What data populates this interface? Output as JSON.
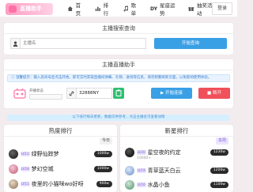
{
  "header": {
    "logo_text": "直播助手",
    "nav": [
      {
        "label": "首页",
        "icon": "home-icon"
      },
      {
        "label": "排行",
        "icon": "chart-icon"
      },
      {
        "label": "歌单",
        "icon": "music-icon"
      },
      {
        "label": "星座运势",
        "prefix": "DY",
        "icon": "star-icon"
      },
      {
        "label": "抽奖活动",
        "badge": "HOT",
        "icon": "gift-icon"
      }
    ],
    "login_label": "登录"
  },
  "query_card": {
    "title": "主播搜索查询",
    "input_placeholder": "主播名",
    "button_label": "开始查询",
    "icon": "user-icon"
  },
  "tool_card": {
    "title": "主播直播助手",
    "notice": "温馨提示：输入房间号后点击开始，即可实时获取直播间弹幕、礼物、进场等信息，请勿频繁刷新页面，以免影响使用体验。",
    "status_label": "开播状态",
    "room_label": "房间号",
    "room_value": "32888NY",
    "start_label": "开始连接",
    "stop_label": "断开"
  },
  "banner_text": "以下排行每日更新，数据仅供参考，点击主播名可查看详情",
  "left_panel": {
    "title": "热度排行",
    "tab_label": "今日",
    "rows": [
      {
        "name": "绿野仙踪梦",
        "count": "1000w",
        "level": "LV12"
      },
      {
        "name": "梦幻空城",
        "count": "1000w",
        "level": "LV18"
      },
      {
        "name": "夜里的小猫咪wo好呀",
        "count": "900w",
        "level": "LV11"
      }
    ]
  },
  "right_panel": {
    "title": "新星排行",
    "tab_label": "本周",
    "rows": [
      {
        "name": "星空夜的约定",
        "sub": "10000+",
        "count": "1230w",
        "level": "LV20"
      },
      {
        "name": "青草蓝天白云",
        "sub": "",
        "count": "1200w",
        "level": "LV19"
      },
      {
        "name": "水晶小鱼",
        "sub": "",
        "count": "1100w",
        "level": "LV16"
      }
    ]
  },
  "colors": {
    "accent_pink": "#ff9ec4",
    "blue_button": "#3aa0e6",
    "green_button": "#2fbf71",
    "red_button": "#f0505a"
  }
}
